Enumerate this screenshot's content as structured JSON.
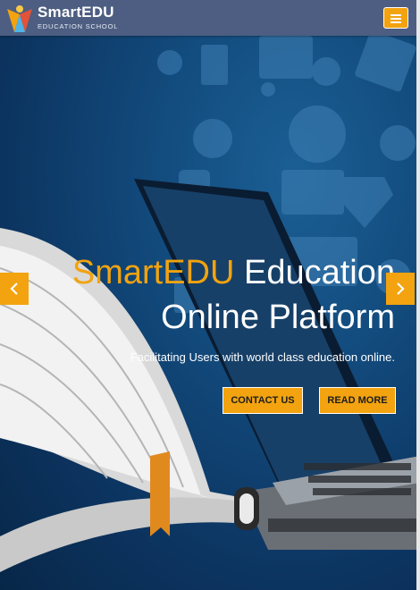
{
  "header": {
    "brand": "SmartEDU",
    "tagline": "EDUCATION SCHOOL",
    "menu_icon": "hamburger-icon"
  },
  "hero": {
    "title_accent": "SmartEDU",
    "title_rest": " Education",
    "title_line2": "Online Platform",
    "subtitle": "Facilitating Users with world class education online.",
    "contact_label": "CONTACT US",
    "readmore_label": "READ MORE",
    "prev_icon": "chevron-left-icon",
    "next_icon": "chevron-right-icon"
  },
  "colors": {
    "accent": "#f2a30f",
    "header_bg": "#4d5e82",
    "hero_bg": "#124a7c"
  }
}
